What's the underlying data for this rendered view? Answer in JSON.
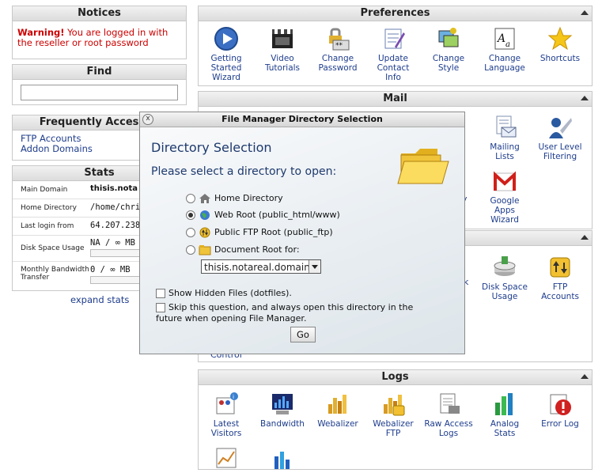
{
  "notices": {
    "title": "Notices",
    "warning_bold": "Warning!",
    "warning_text": " You are logged in with the reseller or root password"
  },
  "find": {
    "title": "Find",
    "value": ""
  },
  "frequently": {
    "title": "Frequently Accessed",
    "links": [
      "FTP Accounts",
      "Addon Domains"
    ]
  },
  "stats": {
    "title": "Stats",
    "rows": [
      {
        "label": "Main Domain",
        "value": "thisis.nota"
      },
      {
        "label": "Home Directory",
        "value": "/home/chri"
      },
      {
        "label": "Last login from",
        "value": "64.207.238"
      },
      {
        "label": "Disk Space Usage",
        "value": "NA / ∞ MB"
      },
      {
        "label": "Monthly Bandwidth Transfer",
        "value": "0 / ∞ MB"
      }
    ],
    "expand": "expand stats"
  },
  "preferences": {
    "title": "Preferences",
    "items": [
      "Getting Started Wizard",
      "Video Tutorials",
      "Change Password",
      "Update Contact Info",
      "Change Style",
      "Change Language",
      "Shortcuts"
    ]
  },
  "mail": {
    "title": "Mail",
    "items": [
      "Mailing Lists",
      "User Level Filtering",
      "Google Apps Wizard"
    ]
  },
  "files": {
    "items": [
      "Disk Space Usage",
      "FTP Accounts"
    ],
    "fragment_k": "k",
    "fragment_y": "y",
    "fragment_control": "Control"
  },
  "logs": {
    "title": "Logs",
    "items": [
      "Latest Visitors",
      "Bandwidth",
      "Webalizer",
      "Webalizer FTP",
      "Raw Access Logs",
      "Analog Stats",
      "Error Log"
    ]
  },
  "dialog": {
    "header": "File Manager Directory Selection",
    "close": "x",
    "title": "Directory Selection",
    "subtitle": "Please select a directory to open:",
    "options": [
      "Home Directory",
      "Web Root (public_html/www)",
      "Public FTP Root (public_ftp)",
      "Document Root for:"
    ],
    "selected_option": "Web Root (public_html/www)",
    "domain_select": "thisis.notareal.domain",
    "show_hidden": "Show Hidden Files (dotfiles).",
    "skip_question": "Skip this question, and always open this directory in the future when opening File Manager.",
    "go": "Go"
  }
}
